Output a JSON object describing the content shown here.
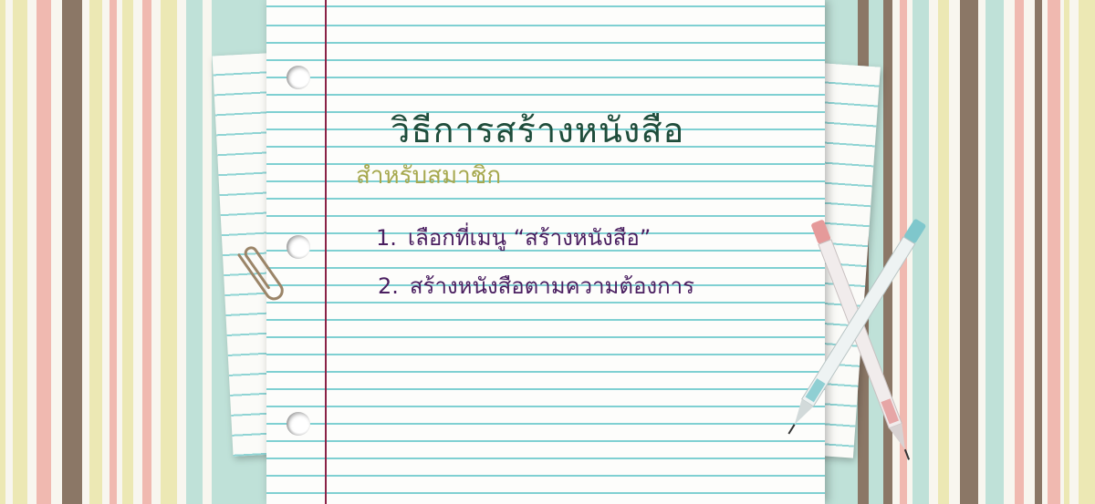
{
  "content": {
    "title": "วิธีการสร้างหนังสือ",
    "subtitle": "สำหรับสมาชิก",
    "steps": [
      {
        "number": "1.",
        "text": "เลือกที่เมนู “สร้างหนังสือ”"
      },
      {
        "number": "2.",
        "text": "สร้างหนังสือตามความต้องการ"
      }
    ]
  },
  "colors": {
    "title": "#1f4d3b",
    "subtitle": "#a6a84e",
    "steps": "#4a1f60",
    "margin_line": "#8a2347",
    "ruled_line": "#7fd0d2",
    "stripe_pink": "#f0b9b0",
    "stripe_brown": "#8b7766",
    "stripe_yellow": "#ece8b4",
    "stripe_mint": "#bfe1d8"
  },
  "decorations": [
    "striped-background",
    "lined-notebook-paper",
    "paper-clip-icon",
    "pink-pen-icon",
    "teal-pen-icon"
  ]
}
